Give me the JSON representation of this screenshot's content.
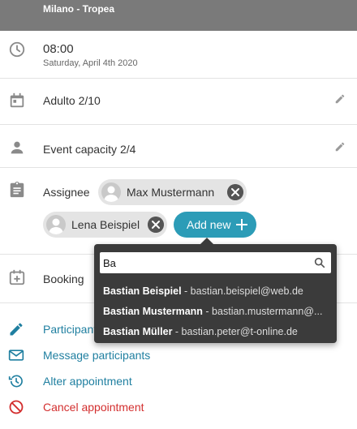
{
  "header": {
    "title": "Milano - Tropea"
  },
  "time": {
    "value": "08:00",
    "date": "Saturday, April 4th 2020"
  },
  "ticket": {
    "label": "Adulto 2/10"
  },
  "capacity": {
    "label": "Event capacity 2/4"
  },
  "assignee": {
    "label": "Assignee",
    "chips": [
      {
        "name": "Max Mustermann"
      },
      {
        "name": "Lena Beispiel"
      }
    ],
    "add_new_label": "Add new"
  },
  "search": {
    "value": "Ba",
    "results": [
      {
        "name": "Bastian Beispiel",
        "email": " - bastian.beispiel@web.de"
      },
      {
        "name": "Bastian Mustermann",
        "email": " - bastian.mustermann@..."
      },
      {
        "name": "Bastian Müller",
        "email": " - bastian.peter@t-online.de"
      }
    ]
  },
  "booking": {
    "label": "Booking"
  },
  "actions": [
    {
      "label": "Participants",
      "color": "#1f7fa0"
    },
    {
      "label": "Message participants",
      "color": "#1f7fa0"
    },
    {
      "label": "Alter appointment",
      "color": "#1f7fa0"
    },
    {
      "label": "Cancel appointment",
      "color": "#d32f2f"
    }
  ],
  "colors": {
    "accent": "#2c9cb7",
    "header": "#7a7a7a",
    "danger": "#d32f2f"
  }
}
